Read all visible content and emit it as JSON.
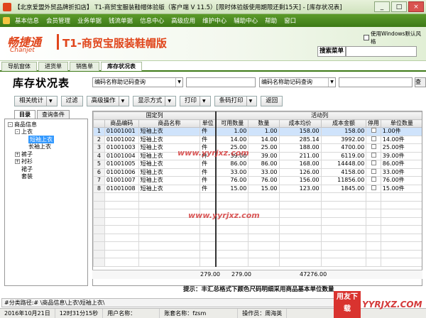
{
  "window": {
    "title": "【北京爱盟外贸品牌折扣店】 T1-商贸宝服装鞋帽体验版（客户端 V 11.5）[限时体验版使用期限还剩15天] - [库存状况表]",
    "buttons": [
      "_",
      "□",
      "×"
    ]
  },
  "menu": [
    "基本信息",
    "会员管理",
    "业务单据",
    "钱流单据",
    "信息中心",
    "高级应用",
    "维护中心",
    "辅助中心",
    "帮助",
    "窗口"
  ],
  "banner": {
    "logo_cn": "畅捷通",
    "logo_en": "Chanjet",
    "product": "T1-商贸宝服装鞋帽版",
    "windows_checkbox": "使用Windows默认风格",
    "search_label": "搜索菜单"
  },
  "tabs": [
    "导航窗体",
    "进货单",
    "销售单",
    "库存状况表"
  ],
  "page": {
    "title": "库存状况表",
    "query1": "编码名称助记码查询",
    "query2": "编码名称助记码查询",
    "query_btn": "查"
  },
  "toolbar": [
    {
      "label": "相关统计",
      "dropdown": true
    },
    {
      "label": "过滤",
      "dropdown": false
    },
    {
      "label": "高级操作",
      "dropdown": true
    },
    {
      "label": "显示方式",
      "dropdown": true
    },
    {
      "label": "打印",
      "dropdown": true
    },
    {
      "label": "条码打印",
      "dropdown": true
    },
    {
      "label": "返回",
      "dropdown": false
    }
  ],
  "left_tabs": [
    "目录",
    "查询条件"
  ],
  "tree": [
    {
      "label": "商品信息",
      "level": 0,
      "exp": "-"
    },
    {
      "label": "上衣",
      "level": 1,
      "exp": "-"
    },
    {
      "label": "短袖上衣",
      "level": 2,
      "exp": "",
      "selected": true
    },
    {
      "label": "长袖上衣",
      "level": 2,
      "exp": ""
    },
    {
      "label": "裤子",
      "level": 1,
      "exp": "+"
    },
    {
      "label": "衬衫",
      "level": 1,
      "exp": "+"
    },
    {
      "label": "裙子",
      "level": 1,
      "exp": ""
    },
    {
      "label": "套装",
      "level": 1,
      "exp": ""
    }
  ],
  "grid": {
    "group_fixed": "固定列",
    "group_active": "活动列",
    "columns": [
      "",
      "商品编码",
      "商品名称",
      "单位",
      "可用数量",
      "数量",
      "成本均价",
      "成本金额",
      "停用",
      "单位数量"
    ],
    "rows": [
      [
        "1",
        "01001001",
        "短袖上衣",
        "件",
        "1.00",
        "1.00",
        "158.00",
        "158.00",
        "1.00件"
      ],
      [
        "2",
        "01001002",
        "短袖上衣",
        "件",
        "14.00",
        "14.00",
        "285.14",
        "3992.00",
        "14.00件"
      ],
      [
        "3",
        "01001003",
        "短袖上衣",
        "件",
        "25.00",
        "25.00",
        "188.00",
        "4700.00",
        "25.00件"
      ],
      [
        "4",
        "01001004",
        "短袖上衣",
        "件",
        "39.00",
        "39.00",
        "211.00",
        "6119.00",
        "39.00件"
      ],
      [
        "5",
        "01001005",
        "短袖上衣",
        "件",
        "86.00",
        "86.00",
        "168.00",
        "14448.00",
        "86.00件"
      ],
      [
        "6",
        "01001006",
        "短袖上衣",
        "件",
        "33.00",
        "33.00",
        "126.00",
        "4158.00",
        "33.00件"
      ],
      [
        "7",
        "01001007",
        "短袖上衣",
        "件",
        "76.00",
        "76.00",
        "156.00",
        "11856.00",
        "76.00件"
      ],
      [
        "8",
        "01001008",
        "短袖上衣",
        "件",
        "15.00",
        "15.00",
        "123.00",
        "1845.00",
        "15.00件"
      ]
    ],
    "totals": {
      "available": "279.00",
      "qty": "279.00",
      "amount": "47276.00"
    }
  },
  "hint": "提示：丰汇总格式下颜色尺码明细采用商品基本单位数量",
  "status_path": "#分类路径:# \\商品信息\\上衣\\短袖上衣\\",
  "status": [
    "2016年10月21日",
    "12时31分15秒",
    "用户名称：",
    "账套名称：fzsm",
    "操作员：周海英"
  ],
  "watermarks": {
    "center": "www.yyrjxz.com",
    "center2": "www.yyrjxz.com",
    "corner_box": "用友下载",
    "corner_text": "YYRJXZ.COM"
  }
}
